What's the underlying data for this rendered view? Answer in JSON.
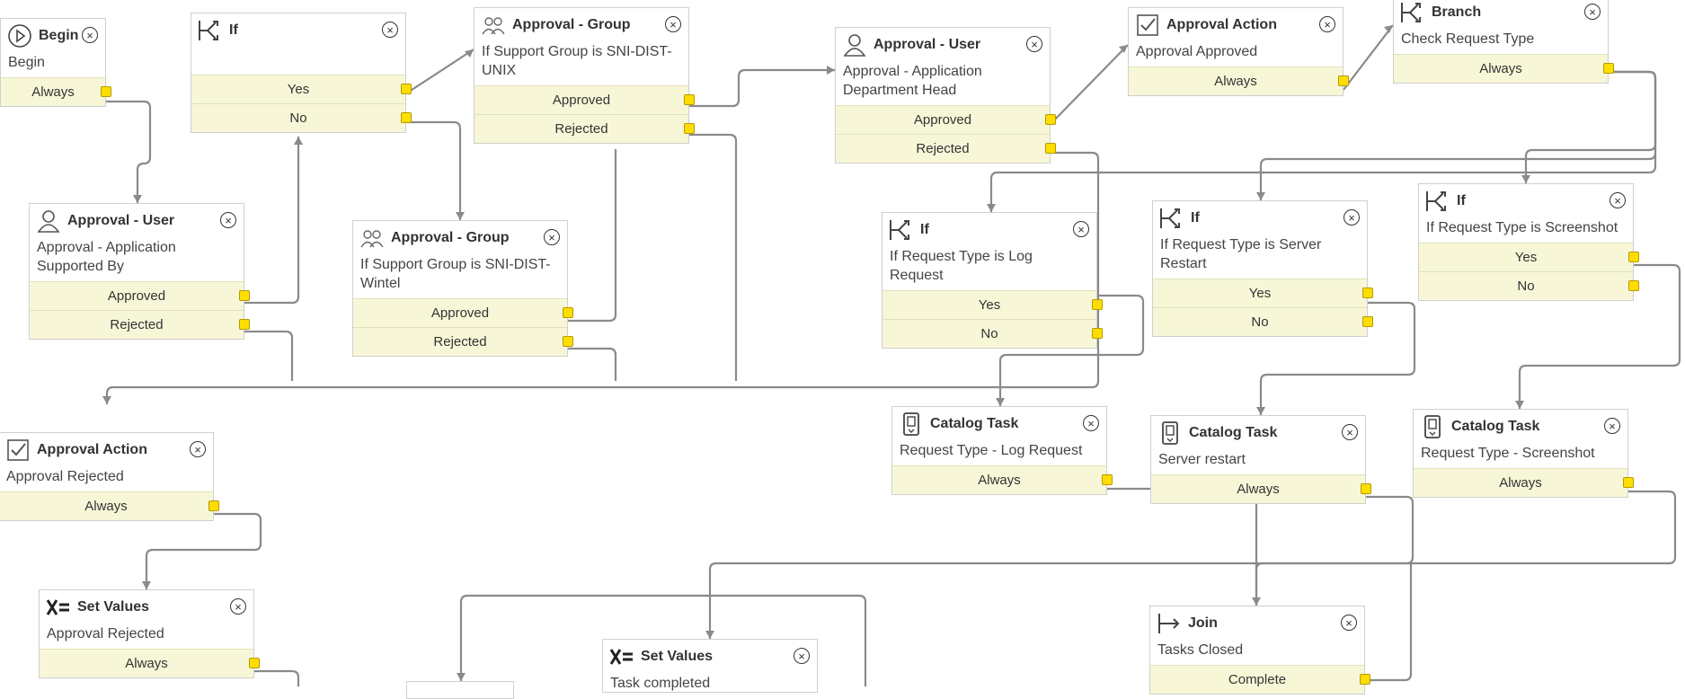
{
  "activities": {
    "begin": {
      "title": "Begin",
      "icon": "play-icon",
      "desc": "Begin",
      "conds": [
        "Always"
      ]
    },
    "if1": {
      "title": "If",
      "icon": "branch-icon",
      "desc": "",
      "conds": [
        "Yes",
        "No"
      ]
    },
    "group_unix": {
      "title": "Approval - Group",
      "icon": "group-icon",
      "desc": "If Support Group is SNI-DIST-UNIX",
      "conds": [
        "Approved",
        "Rejected"
      ]
    },
    "user_depthead": {
      "title": "Approval - User",
      "icon": "user-icon",
      "desc": "Approval - Application Department Head",
      "conds": [
        "Approved",
        "Rejected"
      ]
    },
    "action_approved": {
      "title": "Approval Action",
      "icon": "check-icon",
      "desc": "Approval Approved",
      "conds": [
        "Always"
      ]
    },
    "branch": {
      "title": "Branch",
      "icon": "branch-icon",
      "desc": "Check Request Type",
      "conds": [
        "Always"
      ]
    },
    "user_supported": {
      "title": "Approval - User",
      "icon": "user-icon",
      "desc": "Approval - Application Supported By",
      "conds": [
        "Approved",
        "Rejected"
      ]
    },
    "group_wintel": {
      "title": "Approval - Group",
      "icon": "group-icon",
      "desc": "If Support Group is SNI-DIST-Wintel",
      "conds": [
        "Approved",
        "Rejected"
      ]
    },
    "if_log": {
      "title": "If",
      "icon": "branch-icon",
      "desc": "If Request Type is Log Request",
      "conds": [
        "Yes",
        "No"
      ]
    },
    "if_restart": {
      "title": "If",
      "icon": "branch-icon",
      "desc": "If Request Type is Server Restart",
      "conds": [
        "Yes",
        "No"
      ]
    },
    "if_screenshot": {
      "title": "If",
      "icon": "branch-icon",
      "desc": "If Request Type is Screenshot",
      "conds": [
        "Yes",
        "No"
      ]
    },
    "action_rejected": {
      "title": "Approval Action",
      "icon": "check-icon",
      "desc": "Approval Rejected",
      "conds": [
        "Always"
      ]
    },
    "task_log": {
      "title": "Catalog Task",
      "icon": "task-icon",
      "desc": "Request Type - Log Request",
      "conds": [
        "Always"
      ]
    },
    "task_restart": {
      "title": "Catalog Task",
      "icon": "task-icon",
      "desc": "Server restart",
      "conds": [
        "Always"
      ]
    },
    "task_screenshot": {
      "title": "Catalog Task",
      "icon": "task-icon",
      "desc": "Request Type - Screenshot",
      "conds": [
        "Always"
      ]
    },
    "set_rejected": {
      "title": "Set Values",
      "icon": "setvalues-icon",
      "desc": "Approval Rejected",
      "conds": [
        "Always"
      ]
    },
    "set_completed": {
      "title": "Set Values",
      "icon": "setvalues-icon",
      "desc": "Task completed",
      "conds": []
    },
    "join": {
      "title": "Join",
      "icon": "join-icon",
      "desc": "Tasks Closed",
      "conds": [
        "Complete"
      ]
    }
  },
  "colors": {
    "wire": "#8a8a8a",
    "condition_bg": "#f7f7d8",
    "port": "#ffdd00"
  }
}
